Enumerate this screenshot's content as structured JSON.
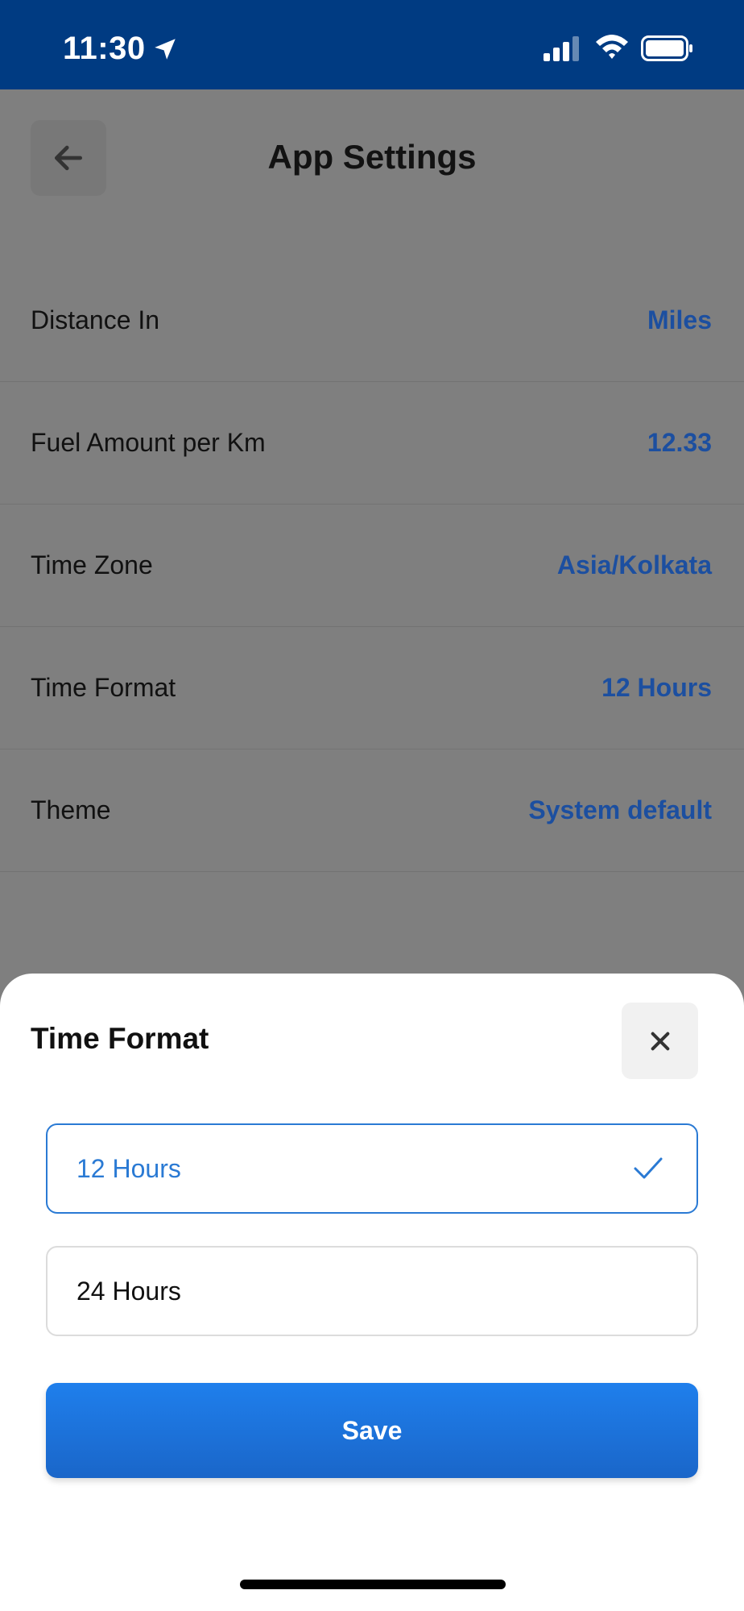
{
  "status_bar": {
    "time": "11:30",
    "icons": [
      "location-arrow-icon",
      "cellular-signal-icon",
      "wifi-icon",
      "battery-icon"
    ]
  },
  "header": {
    "title": "App Settings",
    "back_icon": "arrow-left-icon"
  },
  "settings": [
    {
      "label": "Distance In",
      "value": "Miles"
    },
    {
      "label": "Fuel Amount per Km",
      "value": "12.33"
    },
    {
      "label": "Time Zone",
      "value": "Asia/Kolkata"
    },
    {
      "label": "Time Format",
      "value": "12 Hours"
    },
    {
      "label": "Theme",
      "value": "System default"
    }
  ],
  "sheet": {
    "title": "Time Format",
    "close_icon": "close-icon",
    "options": [
      {
        "label": "12 Hours",
        "selected": true
      },
      {
        "label": "24 Hours",
        "selected": false
      }
    ],
    "check_icon": "checkmark-icon",
    "save_label": "Save"
  },
  "colors": {
    "status_bar": "#003b82",
    "accent": "#2a7ad4",
    "value_text": "#1c4fa0",
    "overlay": "#7f7f7f"
  }
}
